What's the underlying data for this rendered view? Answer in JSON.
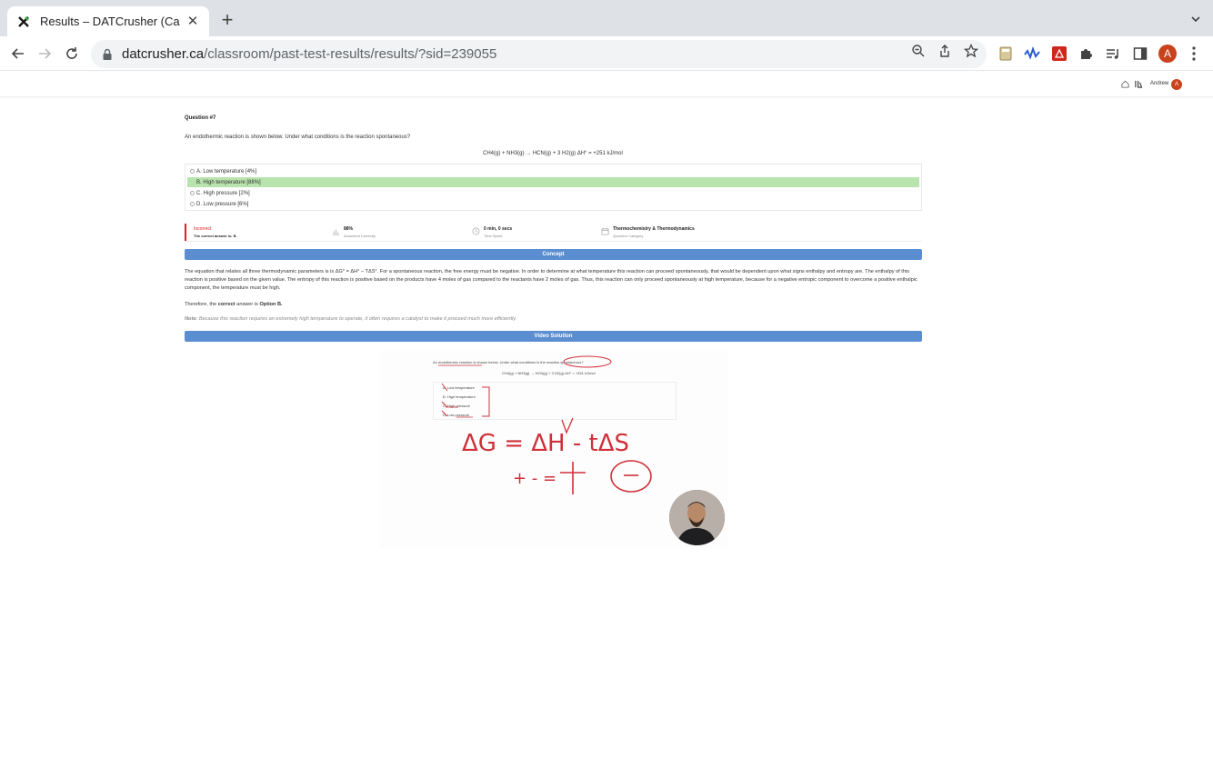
{
  "browser": {
    "tab_title": "Results – DATCrusher (Canadian",
    "url_host": "datcrusher.ca",
    "url_path": "/classroom/past-test-results/results/?sid=239055",
    "profile_initial": "A"
  },
  "header": {
    "user_name": "Andrew",
    "avatar_initial": "A"
  },
  "question": {
    "title": "Question #7",
    "stem": "An endothermic reaction is shown below. Under what conditions is the reaction spontaneous?",
    "equation": "CH4(g) + NH3(g) → HCN(g) + 3 H2(g)   ΔH° = +251 kJ/mol",
    "options": [
      {
        "label": "A. Low temperature [4%]",
        "correct": false
      },
      {
        "label": "B. High temperature [88%]",
        "correct": true
      },
      {
        "label": "C. High pressure [2%]",
        "correct": false
      },
      {
        "label": "D. Low pressure [6%]",
        "correct": false
      }
    ]
  },
  "stats": {
    "result": "Incorrect",
    "correct_answer_prefix": "The correct answer is:",
    "correct_answer": "B.",
    "pct_value": "88%",
    "pct_label": "Answered Correctly",
    "time_value": "0 min, 0 secs",
    "time_label": "Time Spent",
    "category_value": "Thermochemistry & Thermodynamics",
    "category_label": "Question Category"
  },
  "concept": {
    "heading": "Concept",
    "paragraph": "The equation that relates all three thermodynamic parameters is is ΔG° = ΔH° – TΔS°. For a spontaneous reaction, the free energy must be negative. In order to determine at what temperature this reaction can proceed spontaneously, that would be dependent upon what signs enthalpy and entropy are. The enthalpy of this reaction is positive based on the given value. The entropy of this reaction is positive based on the products have 4 moles of gas compared to the reactants have 2 moles of gas. Thus, this reaction can only proceed spontaneously at high temperature, because for a negative entropic component to overcome a positive enthalpic component, the temperature must be high.",
    "answer_prefix": "Therefore, the",
    "answer_bold": "correct",
    "answer_mid": "answer is",
    "answer_option": "Option B.",
    "note_label": "Note:",
    "note_text": "Because this reaction requires an extremely high temperature to operate, it often requires a catalyst to make it proceed much more efficiently."
  },
  "video": {
    "heading": "Video Solution",
    "stem": "An endothermic reaction is shown below. Under what conditions is the reaction spontaneous?",
    "equation": "CH4(g) + NH3(g) → HCN(g) + 3 H2(g)   ΔH° = +251 kJ/mol",
    "options": [
      "A. Low temperature",
      "B. High temperature",
      "C. High pressure",
      "D. Low pressure"
    ],
    "handwriting_equation": "ΔG = ΔH - tΔS",
    "handwriting_signs": "+    -    = "
  }
}
